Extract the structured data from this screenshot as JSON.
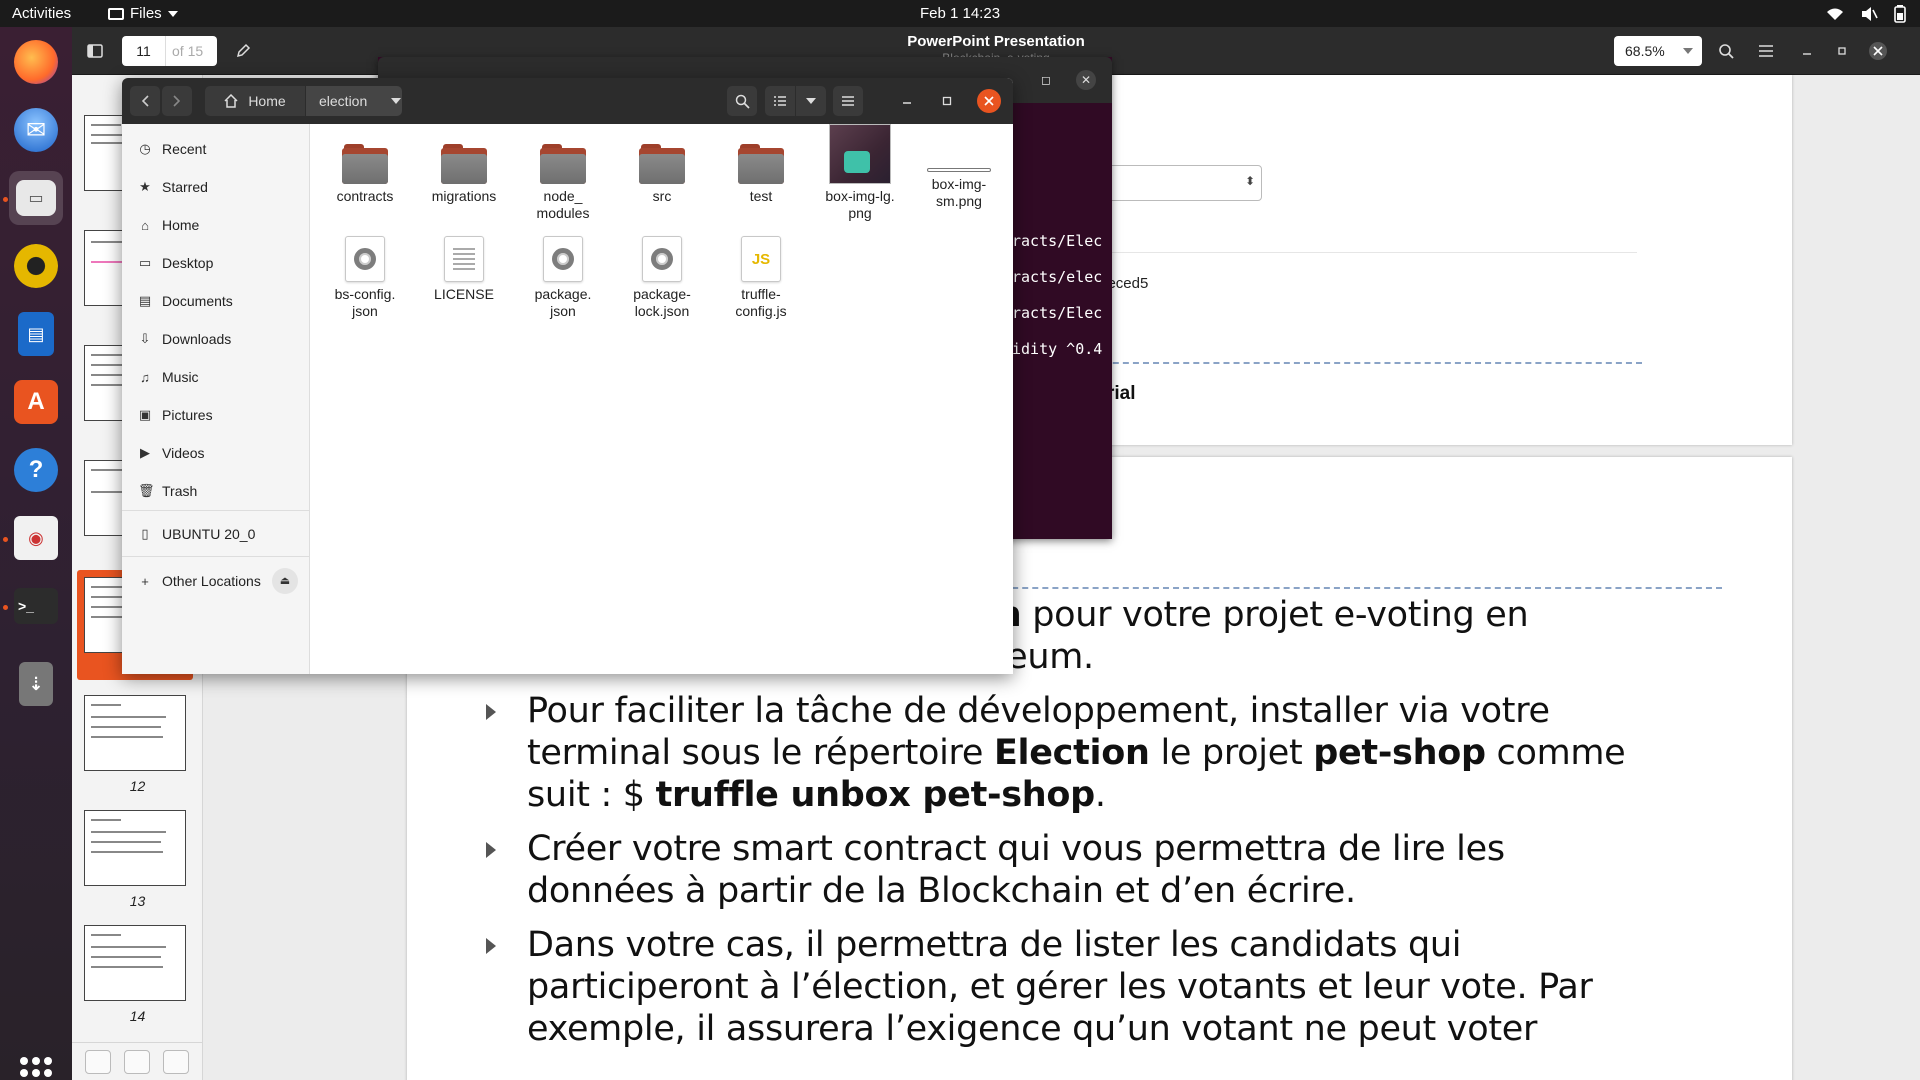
{
  "topbar": {
    "activities": "Activities",
    "app_menu": "Files",
    "clock": "Feb 1  14:23"
  },
  "viewer": {
    "title": "PowerPoint Presentation",
    "subtitle": "Blockchain_e-voting",
    "page_current": "11",
    "page_total": "of 15",
    "zoom": "68.5%",
    "thumb_labels": [
      "12",
      "13",
      "14"
    ],
    "hash_text": "e7c08eb105ef5448eced5",
    "tutorial_text": "eum-dapp-tutorial",
    "slide": {
      "b1_line1_bold": "on",
      "b1_line1_rest": " pour votre projet e-voting en",
      "b1_line2": "utilisant la Blockchain Ethereum.",
      "b2_a": "Pour faciliter la tâche de développement, installer via votre terminal sous le répertoire ",
      "b2_bold1": "Election",
      "b2_b": " le projet ",
      "b2_bold2": "pet-shop",
      "b2_c": " comme suit : $ ",
      "b2_bold3": "truffle unbox pet-shop",
      "b2_d": ".",
      "b3": "Créer votre smart contract qui vous permettra de lire les données à partir de la Blockchain et d’en écrire.",
      "b4": "Dans votre cas, il permettra de lister les candidats qui participeront à l’élection, et gérer les votants et leur vote. Par exemple, il assurera l’exigence qu’un votant ne peut voter"
    }
  },
  "terminal": {
    "lines": [
      "racts/Elec",
      "racts/elec",
      "racts/Elec",
      "idity ^0.4"
    ]
  },
  "files": {
    "path_home": "Home",
    "path_current": "election",
    "sidebar": [
      {
        "label": "Recent",
        "icon": "clock-icon",
        "glyph": "◷"
      },
      {
        "label": "Starred",
        "icon": "star-icon",
        "glyph": "★"
      },
      {
        "label": "Home",
        "icon": "home-icon",
        "glyph": "⌂"
      },
      {
        "label": "Desktop",
        "icon": "desktop-icon",
        "glyph": "▭"
      },
      {
        "label": "Documents",
        "icon": "documents-icon",
        "glyph": "▤"
      },
      {
        "label": "Downloads",
        "icon": "download-icon",
        "glyph": "⇩"
      },
      {
        "label": "Music",
        "icon": "music-icon",
        "glyph": "♫"
      },
      {
        "label": "Pictures",
        "icon": "pictures-icon",
        "glyph": "▣"
      },
      {
        "label": "Videos",
        "icon": "videos-icon",
        "glyph": "▶"
      },
      {
        "label": "Trash",
        "icon": "trash-icon",
        "glyph": "🗑"
      }
    ],
    "drive": "UBUNTU 20_0",
    "other_locations": "Other Locations",
    "items": [
      {
        "name": "contracts",
        "kind": "folder"
      },
      {
        "name": "migrations",
        "kind": "folder"
      },
      {
        "name": "node_\nmodules",
        "kind": "folder"
      },
      {
        "name": "src",
        "kind": "folder"
      },
      {
        "name": "test",
        "kind": "folder"
      },
      {
        "name": "box-img-lg.\npng",
        "kind": "image"
      },
      {
        "name": "box-img-\nsm.png",
        "kind": "image-sm"
      },
      {
        "name": "bs-config.\njson",
        "kind": "json"
      },
      {
        "name": "LICENSE",
        "kind": "text"
      },
      {
        "name": "package.\njson",
        "kind": "json"
      },
      {
        "name": "package-\nlock.json",
        "kind": "json"
      },
      {
        "name": "truffle-\nconfig.js",
        "kind": "js"
      }
    ],
    "js_badge": "JS"
  }
}
